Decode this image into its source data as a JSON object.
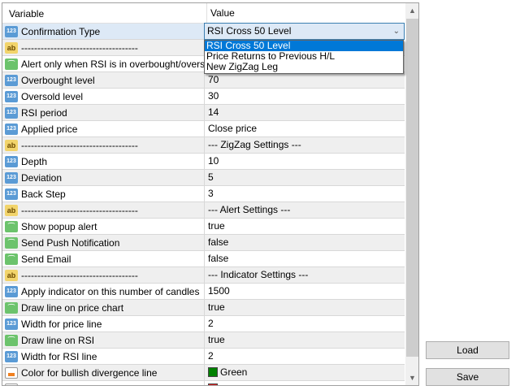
{
  "header": {
    "variable": "Variable",
    "value": "Value"
  },
  "rows": [
    {
      "type": "num",
      "name": "Confirmation Type",
      "value": ""
    },
    {
      "type": "str",
      "name": "------------------------------------",
      "value": ""
    },
    {
      "type": "bool",
      "name": "Alert only when RSI is in overbought/oversol...",
      "value": ""
    },
    {
      "type": "num",
      "name": "Overbought level",
      "value": "70"
    },
    {
      "type": "num",
      "name": "Oversold level",
      "value": "30"
    },
    {
      "type": "num",
      "name": "RSI period",
      "value": "14"
    },
    {
      "type": "num",
      "name": "Applied price",
      "value": "Close price"
    },
    {
      "type": "str",
      "name": "------------------------------------",
      "value": "--- ZigZag Settings ---"
    },
    {
      "type": "num",
      "name": "Depth",
      "value": "10"
    },
    {
      "type": "num",
      "name": "Deviation",
      "value": "5"
    },
    {
      "type": "num",
      "name": "Back Step",
      "value": "3"
    },
    {
      "type": "str",
      "name": "------------------------------------",
      "value": "--- Alert Settings ---"
    },
    {
      "type": "bool",
      "name": "Show popup alert",
      "value": "true"
    },
    {
      "type": "bool",
      "name": "Send Push Notification",
      "value": "false"
    },
    {
      "type": "bool",
      "name": "Send Email",
      "value": "false"
    },
    {
      "type": "str",
      "name": "------------------------------------",
      "value": "--- Indicator Settings ---"
    },
    {
      "type": "num",
      "name": "Apply indicator on this number of candles",
      "value": "1500"
    },
    {
      "type": "bool",
      "name": "Draw line on price chart",
      "value": "true"
    },
    {
      "type": "num",
      "name": "Width for price line",
      "value": "2"
    },
    {
      "type": "bool",
      "name": "Draw line on RSI",
      "value": "true"
    },
    {
      "type": "num",
      "name": "Width for RSI line",
      "value": "2"
    },
    {
      "type": "col",
      "name": "Color for bullish divergence line",
      "value": "Green",
      "swatch": "#008000"
    },
    {
      "type": "col",
      "name": "",
      "value": "",
      "swatch": "#e02020"
    }
  ],
  "combo": {
    "selected": "RSI Cross 50 Level",
    "options": [
      "RSI Cross 50 Level",
      "Price Returns to Previous H/L",
      "New ZigZag Leg"
    ]
  },
  "buttons": {
    "load": "Load",
    "save": "Save"
  },
  "colors": {
    "accent": "#0078d7",
    "selected_row": "#dde9f6"
  }
}
